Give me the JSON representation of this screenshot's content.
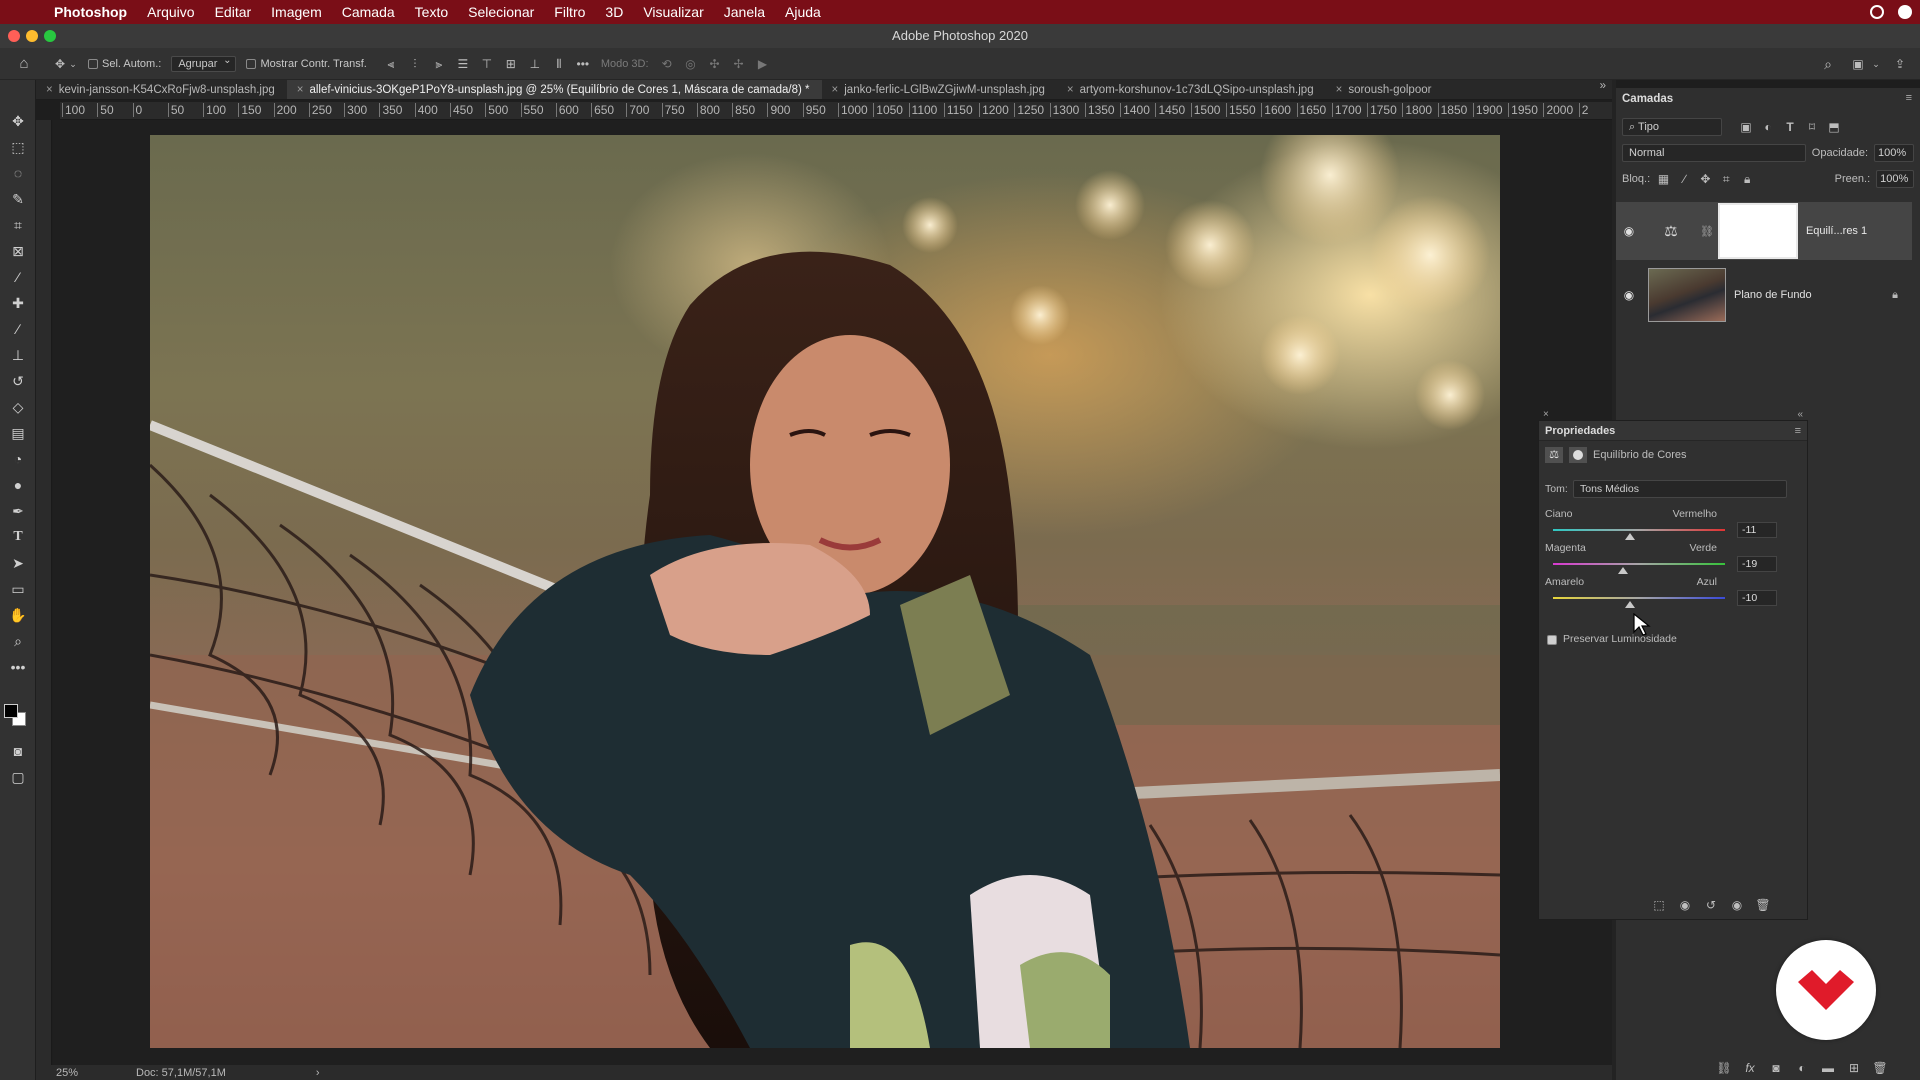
{
  "menubar": {
    "app": "Photoshop",
    "items": [
      "Arquivo",
      "Editar",
      "Imagem",
      "Camada",
      "Texto",
      "Selecionar",
      "Filtro",
      "3D",
      "Visualizar",
      "Janela",
      "Ajuda"
    ]
  },
  "window": {
    "title": "Adobe Photoshop 2020"
  },
  "options_bar": {
    "auto_select_label": "Sel. Autom.:",
    "group_select": "Agrupar",
    "show_transform_label": "Mostrar Contr. Transf.",
    "mode_3d_label": "Modo 3D:"
  },
  "tabs": [
    {
      "label": "kevin-jansson-K54CxRoFjw8-unsplash.jpg",
      "active": false
    },
    {
      "label": "allef-vinicius-3OKgeP1PoY8-unsplash.jpg @ 25% (Equilíbrio de Cores 1, Máscara de camada/8) *",
      "active": true
    },
    {
      "label": "janko-ferlic-LGlBwZGjiwM-unsplash.jpg",
      "active": false
    },
    {
      "label": "artyom-korshunov-1c73dLQSipo-unsplash.jpg",
      "active": false
    },
    {
      "label": "soroush-golpoor",
      "active": false
    }
  ],
  "ruler": {
    "h_ticks": [
      "100",
      "50",
      "0",
      "50",
      "100",
      "150",
      "200",
      "250",
      "300",
      "350",
      "400",
      "450",
      "500",
      "550",
      "600",
      "650",
      "700",
      "750",
      "800",
      "850",
      "900",
      "950",
      "1000",
      "1050",
      "1100",
      "1150",
      "1200",
      "1250",
      "1300",
      "1350",
      "1400",
      "1450",
      "1500",
      "1550",
      "1600",
      "1650",
      "1700",
      "1750",
      "1800",
      "1850",
      "1900",
      "1950",
      "2000",
      "2"
    ]
  },
  "status": {
    "zoom": "25%",
    "doc": "Doc: 57,1M/57,1M"
  },
  "layers_panel": {
    "title": "Camadas",
    "filter": "Tipo",
    "blend_mode": "Normal",
    "opacity_label": "Opacidade:",
    "opacity": "100%",
    "lock_label": "Bloq.:",
    "fill_label": "Preen.:",
    "fill": "100%",
    "layers": [
      {
        "name": "Equilí...res 1",
        "visible": true,
        "selected": true
      },
      {
        "name": "Plano de Fundo",
        "visible": true,
        "selected": false,
        "locked": true
      }
    ]
  },
  "properties_panel": {
    "title": "Propriedades",
    "adjustment": "Equilíbrio de Cores",
    "tone_label": "Tom:",
    "tone": "Tons Médios",
    "sliders": [
      {
        "left": "Ciano",
        "right": "Vermelho",
        "value": "-11",
        "numeric": -11
      },
      {
        "left": "Magenta",
        "right": "Verde",
        "value": "-19",
        "numeric": -19
      },
      {
        "left": "Amarelo",
        "right": "Azul",
        "value": "-10",
        "numeric": -10
      }
    ],
    "preserve_luminosity": "Preservar Luminosidade",
    "preserve_checked": true
  },
  "colors": {
    "menubar": "#7a0e17",
    "logo_red": "#e01b2a"
  }
}
